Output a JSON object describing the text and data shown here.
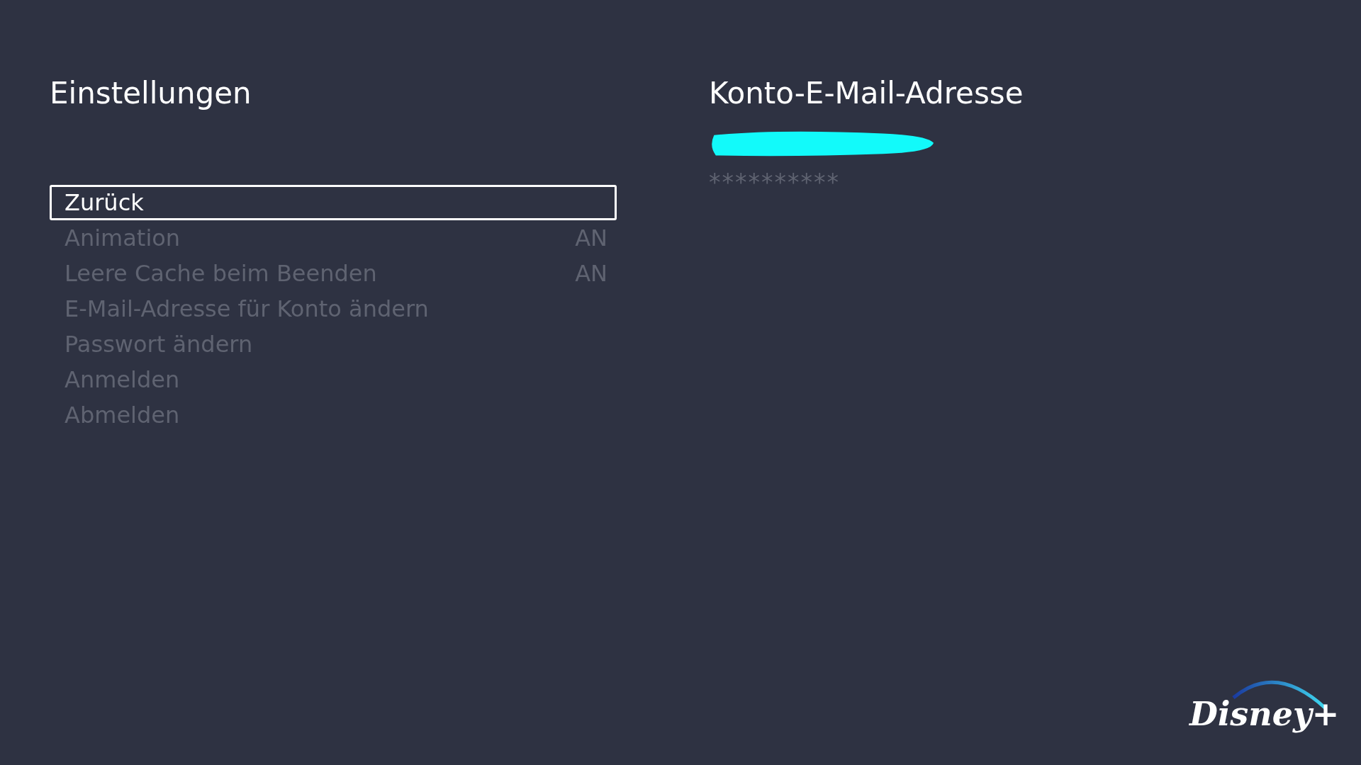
{
  "settings": {
    "title": "Einstellungen",
    "items": [
      {
        "label": "Zurück",
        "selected": true
      },
      {
        "label": "Animation",
        "value": "AN",
        "selected": false
      },
      {
        "label": "Leere Cache beim Beenden",
        "value": "AN",
        "selected": false
      },
      {
        "label": "E-Mail-Adresse für Konto ändern",
        "selected": false
      },
      {
        "label": "Passwort ändern",
        "selected": false
      },
      {
        "label": "Anmelden",
        "selected": false
      },
      {
        "label": "Abmelden",
        "selected": false
      }
    ]
  },
  "account": {
    "title": "Konto-E-Mail-Adresse",
    "email": {
      "redacted": true
    },
    "password": "**********"
  },
  "logo": {
    "text": "Disney+"
  }
}
